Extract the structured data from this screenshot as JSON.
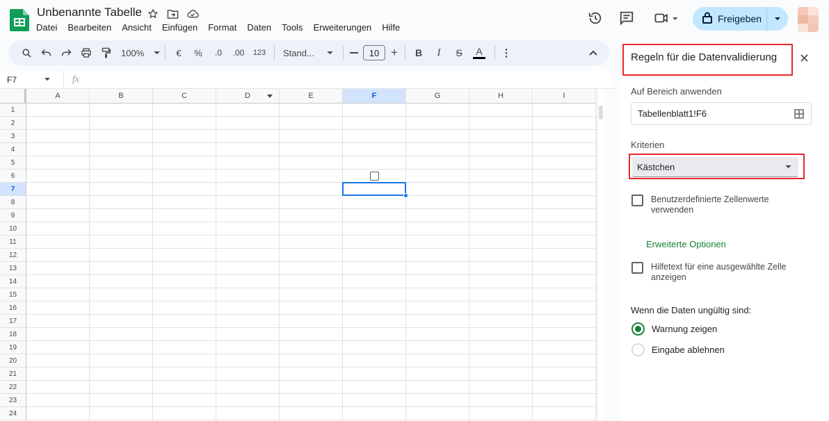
{
  "app": {
    "title": "Unbenannte Tabelle"
  },
  "menu": [
    "Datei",
    "Bearbeiten",
    "Ansicht",
    "Einfügen",
    "Format",
    "Daten",
    "Tools",
    "Erweiterungen",
    "Hilfe"
  ],
  "share": {
    "label": "Freigeben"
  },
  "toolbar": {
    "zoom": "100%",
    "currency": "€",
    "percent": "%",
    "dec_decrease": ".0",
    "dec_increase": ".00",
    "format_number": "123",
    "font": "Stand...",
    "font_size": "10",
    "minus": "—",
    "plus": "+",
    "bold": "B",
    "italic": "I",
    "strike": "S",
    "text_color": "A",
    "more": "⋮"
  },
  "formula_bar": {
    "cell_ref": "F7",
    "fx": "fx",
    "value": ""
  },
  "grid": {
    "columns": [
      "A",
      "B",
      "C",
      "D",
      "E",
      "F",
      "G",
      "H",
      "I"
    ],
    "rows": [
      "1",
      "2",
      "3",
      "4",
      "5",
      "6",
      "7",
      "8",
      "9",
      "10",
      "11",
      "12",
      "13",
      "14",
      "15",
      "16",
      "17",
      "18",
      "19",
      "20",
      "21",
      "22",
      "23",
      "24"
    ],
    "selected_column": "F",
    "selected_row": "7",
    "checkbox_cell": "F6"
  },
  "panel": {
    "title": "Regeln für die Datenvalidierung",
    "range_label": "Auf Bereich anwenden",
    "range_value": "Tabellenblatt1!F6",
    "criteria_label": "Kriterien",
    "criteria_value": "Kästchen",
    "custom_values_label": "Benutzerdefinierte Zellenwerte verwenden",
    "advanced_options": "Erweiterte Optionen",
    "help_text_label": "Hilfetext für eine ausgewählte Zelle anzeigen",
    "invalid_label": "Wenn die Daten ungültig sind:",
    "options": [
      {
        "label": "Warnung zeigen",
        "selected": true
      },
      {
        "label": "Eingabe ablehnen",
        "selected": false
      }
    ]
  },
  "colors": {
    "accent_green": "#188038",
    "share_bg": "#c2e7ff",
    "selection_blue": "#1a73e8",
    "highlight_red": "#e8282a"
  }
}
